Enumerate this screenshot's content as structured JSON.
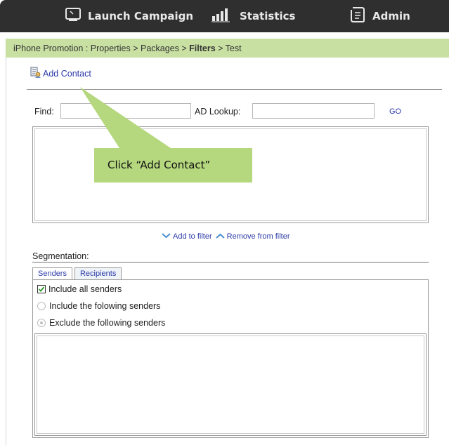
{
  "nav": {
    "launch_label": "Launch Campaign",
    "statistics_label": "Statistics",
    "admin_label": "Admin"
  },
  "breadcrumb": {
    "part1": "iPhone Promotion : Properties > Packages > ",
    "current": "Filters",
    "part2": " > Test"
  },
  "toolbar": {
    "add_contact_label": "Add Contact"
  },
  "find": {
    "find_label": "Find:",
    "find_value": "",
    "ad_lookup_label": "AD Lookup:",
    "ad_lookup_value": "",
    "go_label": "GO"
  },
  "filter_actions": {
    "add_label": "Add to filter",
    "remove_label": "Remove from filter"
  },
  "segmentation": {
    "title": "Segmentation:",
    "tabs": [
      {
        "label": "Senders",
        "active": true
      },
      {
        "label": "Recipients",
        "active": false
      }
    ],
    "options": {
      "include_all": "Include all senders",
      "include_following": "Include the folowing senders",
      "exclude_following": "Exclude the following senders"
    },
    "include_all_checked": true
  },
  "callout": {
    "text": "Click “Add Contact”"
  },
  "colors": {
    "topbar": "#2f2f2f",
    "breadcrumb_bg": "#c9e0a3",
    "link": "#2b3aa8",
    "callout_bg": "#b5d77e"
  }
}
